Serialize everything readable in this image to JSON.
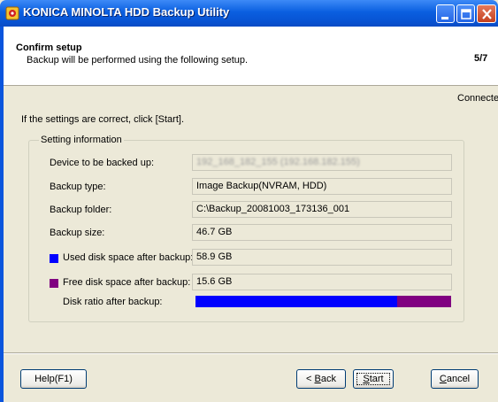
{
  "window": {
    "title": "KONICA MINOLTA HDD Backup Utility"
  },
  "header": {
    "title": "Confirm setup",
    "subtitle": "Backup will be performed using the following setup.",
    "step": "5/7"
  },
  "status": "Connected",
  "instruction": "If the settings are correct, click [Start].",
  "group_label": "Setting information",
  "rows": {
    "device": {
      "label": "Device to be backed up:",
      "value": "192_168_182_155  (192.168.182.155)"
    },
    "type": {
      "label": "Backup type:",
      "value": "Image Backup(NVRAM, HDD)"
    },
    "folder": {
      "label": "Backup folder:",
      "value": "C:\\Backup_20081003_173136_001"
    },
    "size": {
      "label": "Backup size:",
      "value": "46.7 GB"
    },
    "used": {
      "label": "Used disk space after backup:",
      "value": "58.9 GB",
      "color": "#0000ff"
    },
    "free": {
      "label": "Free disk space after backup:",
      "value": "15.6 GB",
      "color": "#800080"
    },
    "ratio": {
      "label": "Disk ratio after backup:",
      "used_fraction": 0.79
    }
  },
  "buttons": {
    "help": "Help(F1)",
    "back_prefix": "< ",
    "back_key": "B",
    "back_rest": "ack",
    "start_key": "S",
    "start_rest": "tart",
    "cancel_key": "C",
    "cancel_rest": "ancel"
  },
  "colors": {
    "titlebar": "#0a5fe0",
    "used": "#0000ff",
    "free": "#800080"
  }
}
